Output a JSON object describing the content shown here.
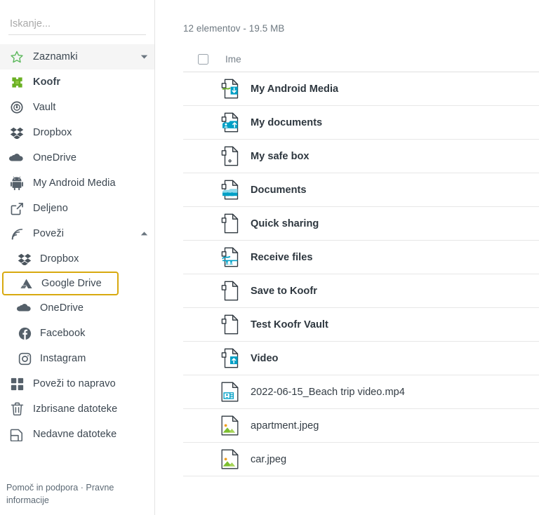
{
  "search": {
    "placeholder": "Iskanje...",
    "value": ""
  },
  "sidebar": {
    "items": [
      {
        "label": "Zaznamki",
        "icon": "star-icon",
        "caret": "down",
        "level": 0,
        "bold": false,
        "active": true,
        "highlighted": false
      },
      {
        "label": "Koofr",
        "icon": "koofr-logo-icon",
        "caret": "",
        "level": 0,
        "bold": true,
        "active": false,
        "highlighted": false
      },
      {
        "label": "Vault",
        "icon": "vault-lock-icon",
        "caret": "",
        "level": 0,
        "bold": false,
        "active": false,
        "highlighted": false
      },
      {
        "label": "Dropbox",
        "icon": "dropbox-icon",
        "caret": "",
        "level": 0,
        "bold": false,
        "active": false,
        "highlighted": false
      },
      {
        "label": "OneDrive",
        "icon": "onedrive-cloud-icon",
        "caret": "",
        "level": 0,
        "bold": false,
        "active": false,
        "highlighted": false
      },
      {
        "label": "My Android Media",
        "icon": "android-icon",
        "caret": "",
        "level": 0,
        "bold": false,
        "active": false,
        "highlighted": false
      },
      {
        "label": "Deljeno",
        "icon": "share-external-icon",
        "caret": "",
        "level": 0,
        "bold": false,
        "active": false,
        "highlighted": false
      },
      {
        "label": "Poveži",
        "icon": "connect-rss-icon",
        "caret": "up",
        "level": 0,
        "bold": false,
        "active": false,
        "highlighted": false
      },
      {
        "label": "Dropbox",
        "icon": "dropbox-icon",
        "caret": "",
        "level": 1,
        "bold": false,
        "active": false,
        "highlighted": false
      },
      {
        "label": "Google Drive",
        "icon": "google-drive-icon",
        "caret": "",
        "level": 1,
        "bold": false,
        "active": false,
        "highlighted": true
      },
      {
        "label": "OneDrive",
        "icon": "onedrive-cloud-icon",
        "caret": "",
        "level": 1,
        "bold": false,
        "active": false,
        "highlighted": false
      },
      {
        "label": "Facebook",
        "icon": "facebook-icon",
        "caret": "",
        "level": 1,
        "bold": false,
        "active": false,
        "highlighted": false
      },
      {
        "label": "Instagram",
        "icon": "instagram-icon",
        "caret": "",
        "level": 1,
        "bold": false,
        "active": false,
        "highlighted": false
      },
      {
        "label": "Poveži to napravo",
        "icon": "grid-devices-icon",
        "caret": "",
        "level": 0,
        "bold": false,
        "active": false,
        "highlighted": false
      },
      {
        "label": "Izbrisane datoteke",
        "icon": "trash-icon",
        "caret": "",
        "level": 0,
        "bold": false,
        "active": false,
        "highlighted": false
      },
      {
        "label": "Nedavne datoteke",
        "icon": "recent-file-icon",
        "caret": "",
        "level": 0,
        "bold": false,
        "active": false,
        "highlighted": false
      }
    ],
    "footer": {
      "help_label": "Pomoč in podpora",
      "separator": " · ",
      "legal_label": "Pravne informacije"
    },
    "highlight_color": "#d8a90f"
  },
  "main": {
    "summary": "12 elementov - 19.5 MB",
    "select_all_checked": false,
    "columns": {
      "name": "Ime"
    },
    "rows": [
      {
        "name": "My Android Media",
        "icon": "folder-receive-icon",
        "type": "folder"
      },
      {
        "name": "My documents",
        "icon": "folder-shared-up-icon",
        "type": "folder"
      },
      {
        "name": "My safe box",
        "icon": "folder-safe-icon",
        "type": "folder"
      },
      {
        "name": "Documents",
        "icon": "folder-shared-icon",
        "type": "folder"
      },
      {
        "name": "Quick sharing",
        "icon": "folder-plain-icon",
        "type": "folder"
      },
      {
        "name": "Receive files",
        "icon": "folder-receivers-icon",
        "type": "folder"
      },
      {
        "name": "Save to Koofr",
        "icon": "folder-plain-icon",
        "type": "folder"
      },
      {
        "name": "Test Koofr Vault",
        "icon": "folder-plain-icon",
        "type": "folder"
      },
      {
        "name": "Video",
        "icon": "folder-upload-icon",
        "type": "folder"
      },
      {
        "name": "2022-06-15_Beach trip video.mp4",
        "icon": "video-file-icon",
        "type": "file"
      },
      {
        "name": "apartment.jpeg",
        "icon": "image-file-icon",
        "type": "file"
      },
      {
        "name": "car.jpeg",
        "icon": "image-file-icon",
        "type": "file"
      }
    ]
  },
  "colors": {
    "accent_green": "#6ab023",
    "accent_teal": "#00a0c6",
    "text": "#343d45",
    "muted": "#77818a",
    "highlight": "#d8a90f"
  }
}
